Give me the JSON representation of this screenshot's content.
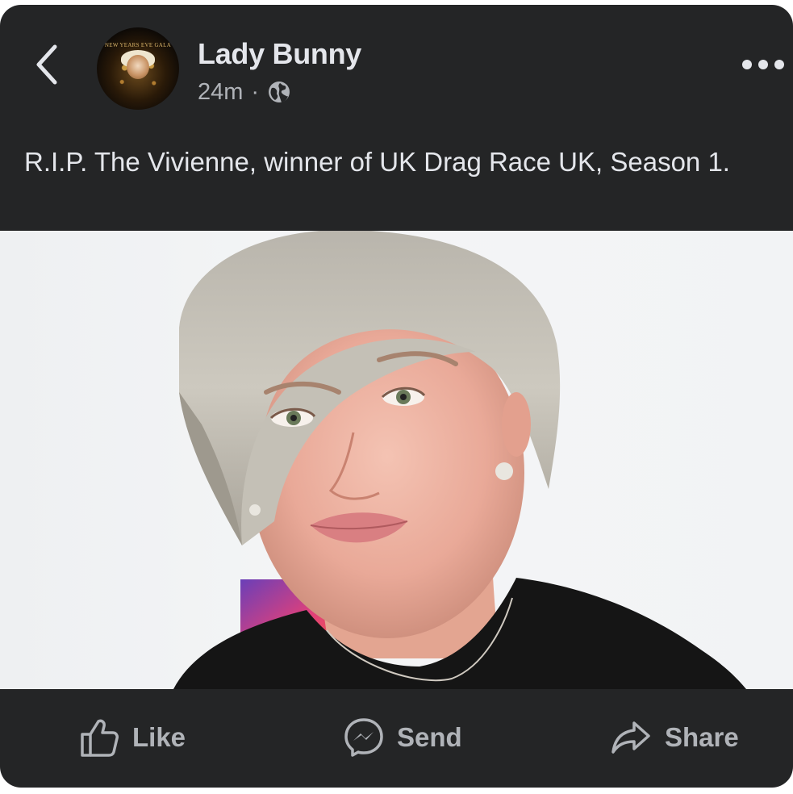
{
  "post": {
    "author": "Lady Bunny",
    "time": "24m",
    "separator": "·",
    "visibility_icon": "globe-icon",
    "text": "R.I.P. The Vivienne, winner of UK Drag Race UK, Season 1.",
    "avatar": {
      "title": "NEW YEARS EVE GALA",
      "subtitle": "",
      "logo_lettering": "NEW YEARS EVE GALA"
    }
  },
  "actions": {
    "like": "Like",
    "send": "Send",
    "share": "Share"
  },
  "icons": {
    "back": "chevron-left-icon",
    "more": "more-horizontal-icon",
    "like": "thumbs-up-icon",
    "send": "messenger-icon",
    "share": "share-arrow-icon"
  },
  "colors": {
    "card_background": "#242526",
    "primary_text": "#e4e6eb",
    "secondary_text": "#b0b3b8",
    "page_background": "#ffffff"
  }
}
